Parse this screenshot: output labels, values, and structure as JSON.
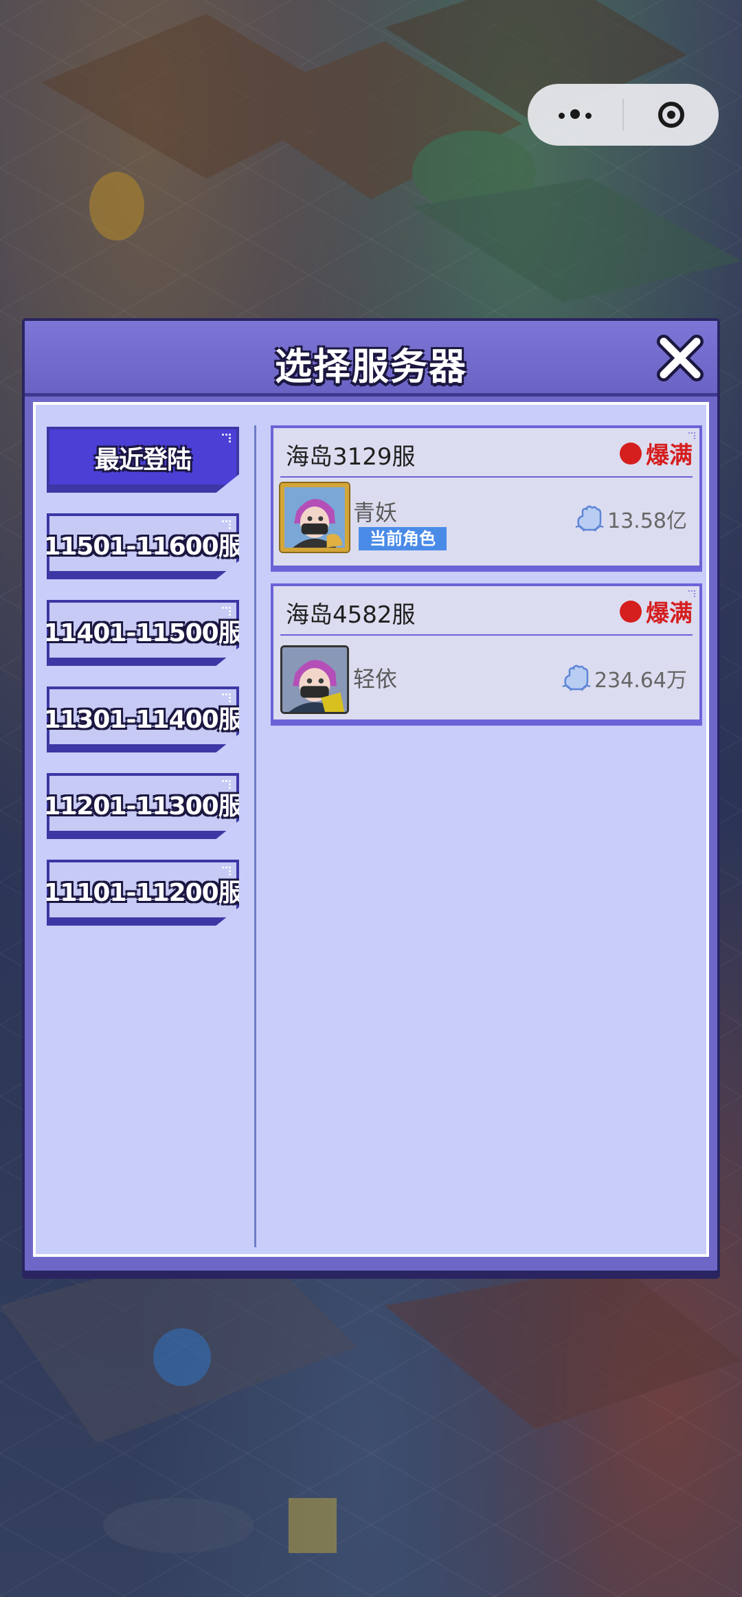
{
  "dialog": {
    "title": "选择服务器"
  },
  "tabs": [
    {
      "label": "最近登陆",
      "active": true
    },
    {
      "label": "11501-11600服",
      "active": false
    },
    {
      "label": "11401-11500服",
      "active": false
    },
    {
      "label": "11301-11400服",
      "active": false
    },
    {
      "label": "11201-11300服",
      "active": false
    },
    {
      "label": "11101-11200服",
      "active": false
    }
  ],
  "servers": [
    {
      "name": "海岛3129服",
      "status": "爆满",
      "role": "青妖",
      "badge": "当前角色",
      "power": "13.58亿",
      "avatar_frame": "gold"
    },
    {
      "name": "海岛4582服",
      "status": "爆满",
      "role": "轻依",
      "power": "234.64万",
      "avatar_frame": "plain"
    }
  ],
  "colors": {
    "status": "#d51e1e",
    "badge": "#4a8be8",
    "active_tab": "#4b3fd6",
    "panel": "#c8cdfa"
  },
  "icons": {
    "more": "more-dots-icon",
    "target": "target-icon",
    "close": "close-icon",
    "power": "fist-icon",
    "status": "status-dot-icon"
  }
}
